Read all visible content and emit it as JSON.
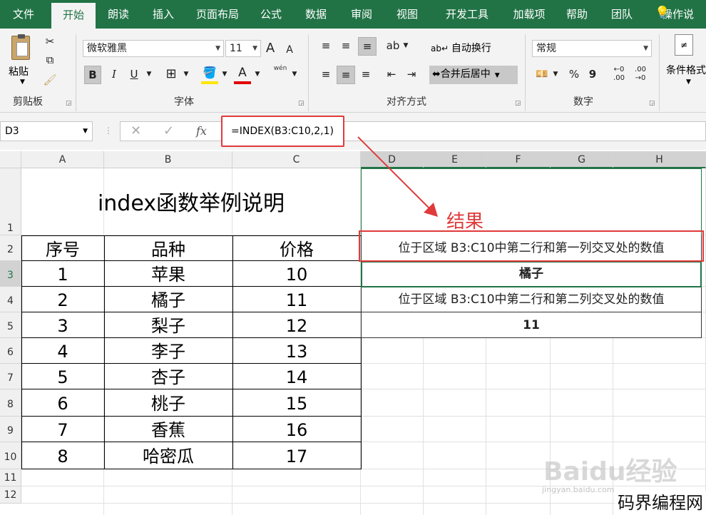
{
  "menu": {
    "tabs": [
      "文件",
      "开始",
      "朗读",
      "插入",
      "页面布局",
      "公式",
      "数据",
      "审阅",
      "视图",
      "开发工具",
      "加载项",
      "帮助",
      "团队",
      "操作说"
    ]
  },
  "ribbon": {
    "clipboard": {
      "paste": "粘贴",
      "label": "剪贴板"
    },
    "font": {
      "name": "微软雅黑",
      "size": "11",
      "bold": "B",
      "italic": "I",
      "underline": "U",
      "label": "字体",
      "grow": "A",
      "shrink": "A",
      "phonetic": "wén"
    },
    "align": {
      "wrap": "自动换行",
      "merge": "合并后居中",
      "label": "对齐方式"
    },
    "number": {
      "format": "常规",
      "percent": "%",
      "comma": "9",
      "label": "数字"
    },
    "styles": {
      "conditional": "条件格式"
    }
  },
  "formula_bar": {
    "name_box": "D3",
    "fx": "fx",
    "formula": "=INDEX(B3:C10,2,1)"
  },
  "columns": [
    "A",
    "B",
    "C",
    "D",
    "E",
    "F",
    "G",
    "H"
  ],
  "rows": [
    "1",
    "2",
    "3",
    "4",
    "5",
    "6",
    "7",
    "8",
    "9",
    "10",
    "11",
    "12"
  ],
  "sheet": {
    "title": "index函数举例说明",
    "headers": [
      "序号",
      "品种",
      "价格"
    ],
    "data": [
      [
        "1",
        "苹果",
        "10"
      ],
      [
        "2",
        "橘子",
        "11"
      ],
      [
        "3",
        "梨子",
        "12"
      ],
      [
        "4",
        "李子",
        "13"
      ],
      [
        "5",
        "杏子",
        "14"
      ],
      [
        "6",
        "桃子",
        "15"
      ],
      [
        "7",
        "香蕉",
        "16"
      ],
      [
        "8",
        "哈密瓜",
        "17"
      ]
    ],
    "result_label": "结果",
    "desc1": "位于区域 B3:C10中第二行和第一列交叉处的数值",
    "result1": "橘子",
    "desc2": "位于区域 B3:C10中第二行和第二列交叉处的数值",
    "result2": "11"
  },
  "watermark": {
    "brand": "Baidu经验",
    "site": "jingyan.baidu.com",
    "corner": "码界编程网"
  }
}
